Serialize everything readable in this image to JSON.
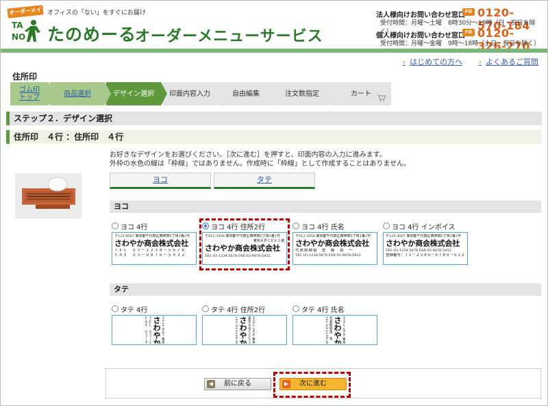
{
  "header": {
    "badge": "オーダーメイド",
    "tagline": "オフィスの「ない」をすぐにお届け",
    "brand": "たのめーる",
    "service": "オーダーメニューサービス",
    "contacts": [
      {
        "title": "法人様向けお問い合わせ窓口",
        "freedial": "FD",
        "number": "0120-570-184",
        "hours": "受付時間：月曜～土曜　8時30分～19時（日・祝日を除く）"
      },
      {
        "title": "個人様向けお問い合わせ窓口",
        "freedial": "FD",
        "number": "0120-326-270",
        "hours": "受付時間：月曜～金曜　9時～18時（土日・祝日を除く）"
      }
    ]
  },
  "links": {
    "beginner": "はじめての方へ",
    "faq": "よくあるご質問"
  },
  "page_title": "住所印",
  "steps": [
    "ゴム印トップ",
    "商品選択",
    "デザイン選択",
    "印面内容入力",
    "自由編集",
    "注文数指定",
    "カート"
  ],
  "section_step": "ステップ２．デザイン選択",
  "section_product": "住所印　４行 ：住所印　４行",
  "instructions": [
    "お好きなデザインをお選びください。［次に進む］を押すと、印面内容の入力に進みます。",
    "外枠の水色の線は「枠線」ではありません。作成時に「枠線」として作成することはありません。"
  ],
  "tabs": {
    "yoko": "ヨコ",
    "tate": "タテ"
  },
  "groups": {
    "yoko": "ヨコ",
    "tate": "タテ"
  },
  "sample_text": {
    "addr": "〒123-4567 東京都千代田区西神田0丁目1番2号",
    "addr2": "〒012-3456 東京都千代田区西神田0丁目1番2号",
    "bldg": "東京ＡＢＣビル１階",
    "company": "さわやか商会株式会社",
    "tel": "ＴＥＬ　０３－１２３４－５６７８",
    "fax": "ＦＡＸ　０３－９８７６－５４３２",
    "telfax": "TEL 03-1234-5678 FAX 03-9876-5432",
    "rep": "代表取締役　佐　藤　真　一",
    "reg": "登録番号：Ｔ１－２３４５－６７８９－０１２３"
  },
  "yoko_options": [
    {
      "label": "ヨコ 4行",
      "selected": false
    },
    {
      "label": "ヨコ 4行 住所2行",
      "selected": true
    },
    {
      "label": "ヨコ 4行 氏名",
      "selected": false
    },
    {
      "label": "ヨコ 4行 インボイス",
      "selected": false
    }
  ],
  "tate_options": [
    {
      "label": "タテ 4行",
      "selected": false
    },
    {
      "label": "タテ 4行 住所2行",
      "selected": false
    },
    {
      "label": "タテ 4行 氏名",
      "selected": false
    }
  ],
  "buttons": {
    "back": "前に戻る",
    "next": "次に進む",
    "back_icon": "◀",
    "next_icon": "▶"
  }
}
